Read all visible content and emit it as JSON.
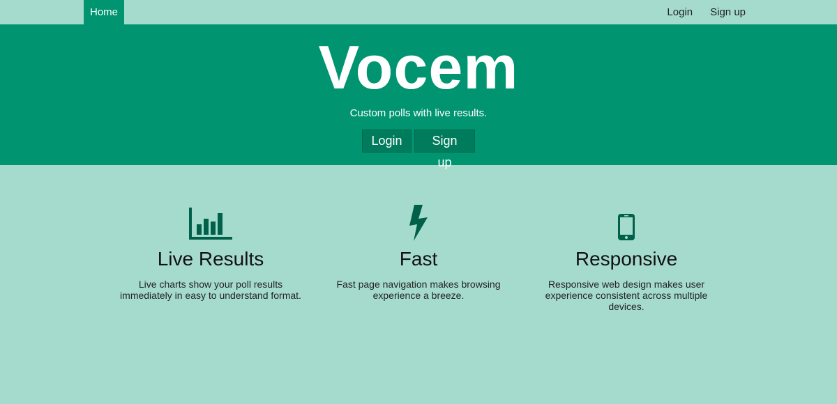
{
  "nav": {
    "home_label": "Home",
    "login_label": "Login",
    "signup_label": "Sign up"
  },
  "hero": {
    "brand": "Vocem",
    "tagline": "Custom polls with live results.",
    "login_button": "Login",
    "signup_button": "Sign up"
  },
  "features": [
    {
      "icon": "bar-chart-icon",
      "title": "Live Results",
      "text": "Live charts show your poll results immediately in easy to understand format."
    },
    {
      "icon": "lightning-bolt-icon",
      "title": "Fast",
      "text": "Fast page navigation makes browsing experience a breeze."
    },
    {
      "icon": "mobile-phone-icon",
      "title": "Responsive",
      "text": "Responsive web design makes user experience consistent across multiple devices."
    }
  ],
  "colors": {
    "page_background": "#a5dbcd",
    "hero_background": "#009570",
    "button_background": "#007c5c",
    "icon_color": "#00604a"
  }
}
